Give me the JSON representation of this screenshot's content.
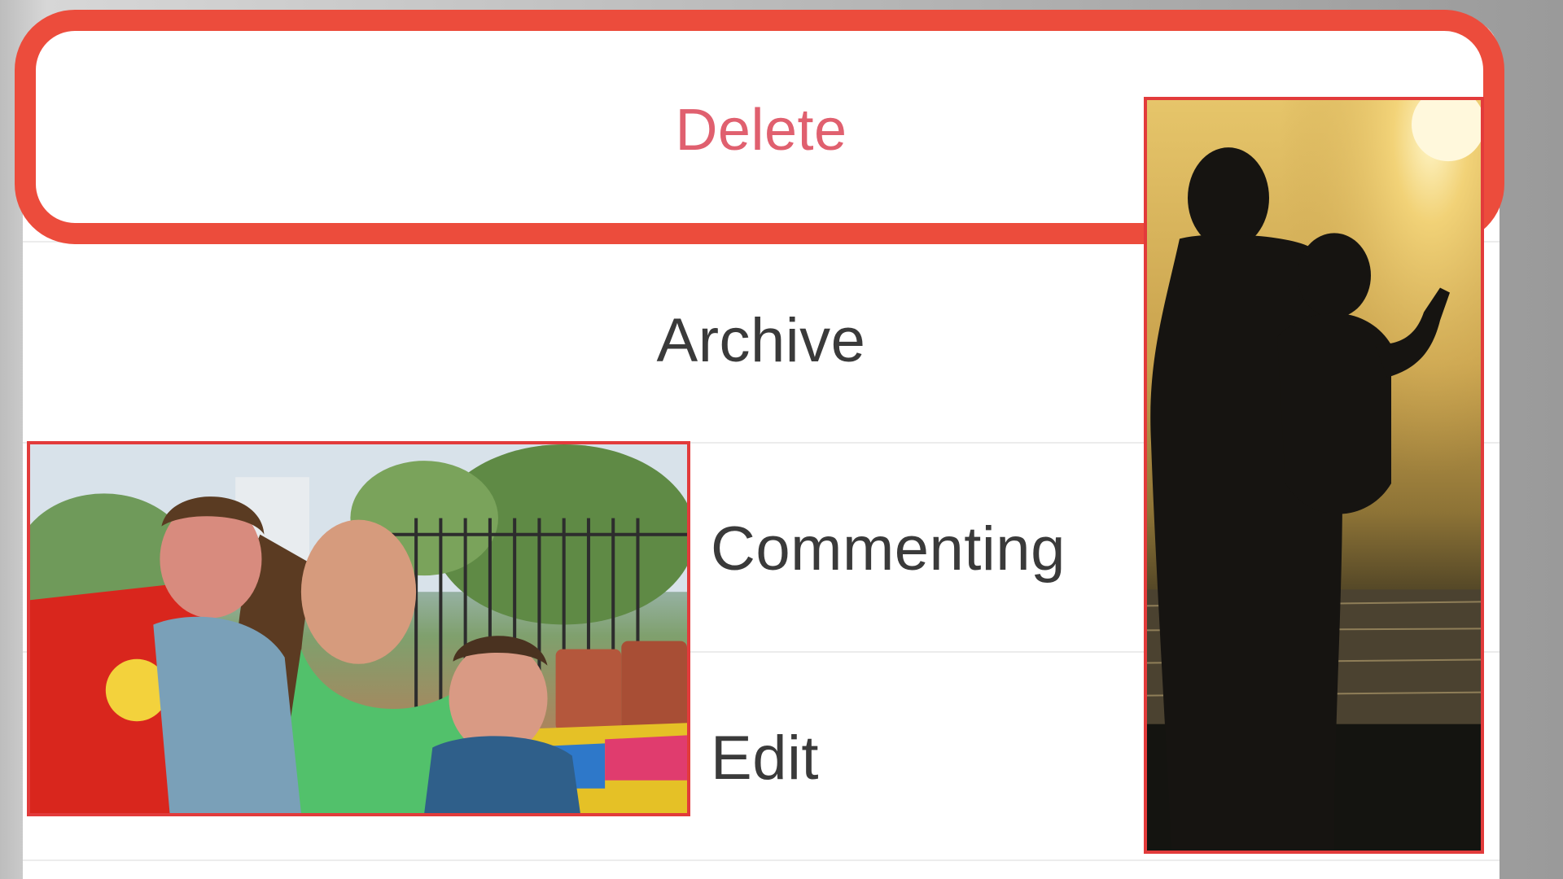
{
  "action_sheet": {
    "items": [
      {
        "label": "Delete",
        "destructive": true,
        "highlighted": true
      },
      {
        "label": "Archive"
      },
      {
        "label": "Commenting"
      },
      {
        "label": "Edit"
      }
    ]
  },
  "colors": {
    "destructive_text": "#e0606f",
    "highlight_outline": "#ec4c3c",
    "photo_frame": "#e23b3b",
    "item_text": "#3a3a3a"
  },
  "overlays": {
    "left_photo": {
      "subject": "woman-and-two-children-holi-photo"
    },
    "right_photo": {
      "subject": "silhouette-mother-and-child-sunset-photo"
    }
  }
}
